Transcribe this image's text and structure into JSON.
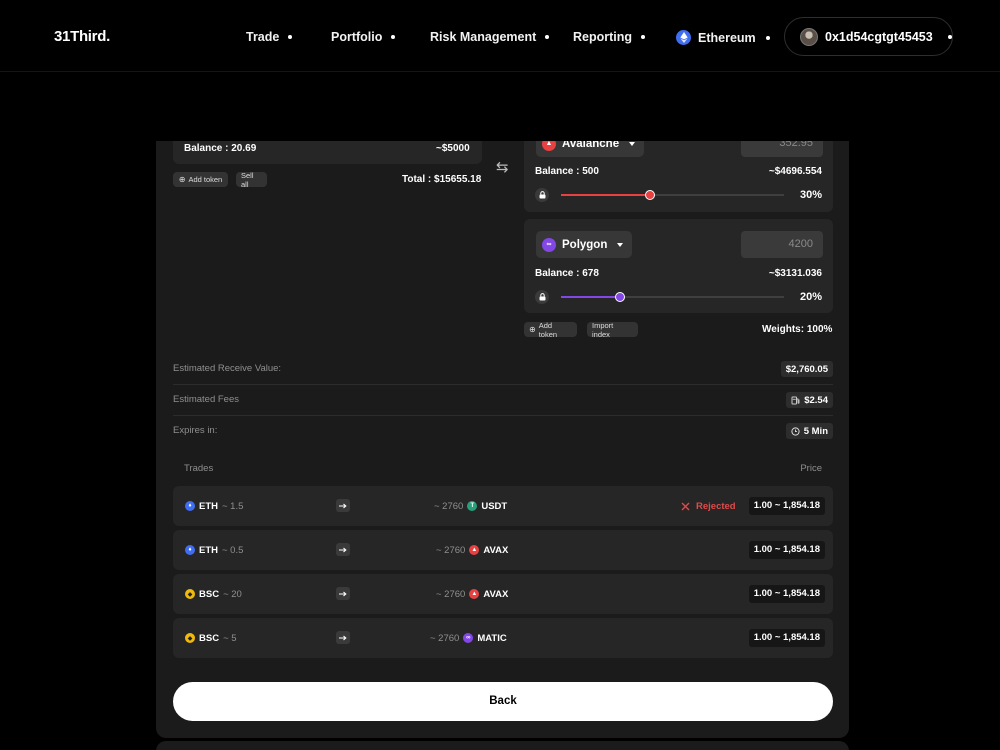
{
  "header": {
    "logo": "31Third.",
    "nav": [
      {
        "label": "Trade"
      },
      {
        "label": "Portfolio"
      },
      {
        "label": "Risk Management"
      },
      {
        "label": "Reporting"
      }
    ],
    "network": "Ethereum",
    "wallet_address": "0x1d54cgtgt45453"
  },
  "sell_side": {
    "balance": "Balance : 20.69",
    "usd": "~$5000",
    "add_token": "Add token",
    "sell_all": "Sell all",
    "total": "Total : $15655.18"
  },
  "buy_side": {
    "tokens": [
      {
        "name": "Avalanche",
        "amount": "352.95",
        "balance": "Balance : 500",
        "usd": "~$4696.554",
        "percent": "30%",
        "weight": 0.3,
        "color": "#e84142"
      },
      {
        "name": "Polygon",
        "amount": "4200",
        "balance": "Balance : 678",
        "usd": "~$3131.036",
        "percent": "20%",
        "weight": 0.2,
        "color": "#8247e5"
      }
    ],
    "add_token": "Add token",
    "import_index": "Import index",
    "weights": "Weights: 100%"
  },
  "summary": {
    "receive_label": "Estimated Receive Value:",
    "receive_value": "$2,760.05",
    "fees_label": "Estimated Fees",
    "fees_value": "$2.54",
    "expires_label": "Expires in:",
    "expires_value": "5 Min"
  },
  "trades": {
    "header_trades": "Trades",
    "header_price": "Price",
    "rows": [
      {
        "from": "ETH",
        "from_qty": "~ 1.5",
        "to_qty": "~ 2760",
        "to": "USDT",
        "status": "Rejected",
        "price": "1.00 ~ 1,854.18"
      },
      {
        "from": "ETH",
        "from_qty": "~ 0.5",
        "to_qty": "~ 2760",
        "to": "AVAX",
        "status": "",
        "price": "1.00 ~ 1,854.18"
      },
      {
        "from": "BSC",
        "from_qty": "~ 20",
        "to_qty": "~ 2760",
        "to": "AVAX",
        "status": "",
        "price": "1.00 ~ 1,854.18"
      },
      {
        "from": "BSC",
        "from_qty": "~ 5",
        "to_qty": "~ 2760",
        "to": "MATIC",
        "status": "",
        "price": "1.00 ~ 1,854.18"
      }
    ]
  },
  "back_button": "Back",
  "colors": {
    "eth": "#3f6ef1",
    "bsc": "#f0b90b",
    "usdt": "#26a17b",
    "avax": "#e84142",
    "matic": "#8247e5",
    "rejected": "#e04a4a"
  }
}
